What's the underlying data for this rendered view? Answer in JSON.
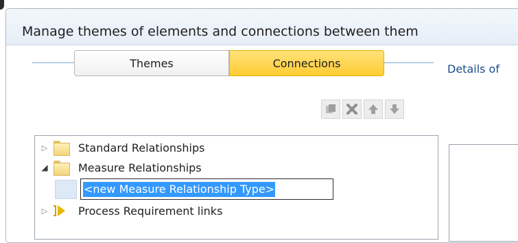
{
  "window": {
    "title": "Manage themes of elements and connections between them"
  },
  "tabs": [
    {
      "label": "Themes",
      "active": false
    },
    {
      "label": "Connections",
      "active": true
    }
  ],
  "details_label": "Details of",
  "toolbar": {
    "buttons": [
      {
        "icon": "copy-icon"
      },
      {
        "icon": "delete-icon"
      },
      {
        "icon": "move-up-icon"
      },
      {
        "icon": "move-down-icon"
      }
    ]
  },
  "tree": {
    "items": [
      {
        "label": "Standard Relationships",
        "expanded": false,
        "icon": "folder-icon"
      },
      {
        "label": "Measure Relationships",
        "expanded": true,
        "icon": "folder-icon"
      },
      {
        "label": "Process Requirement links",
        "expanded": false,
        "icon": "process-link-icon"
      }
    ],
    "editing": {
      "value": "<new Measure Relationship Type>"
    }
  },
  "colors": {
    "active_tab": "#ffcc33",
    "selection": "#3399ff",
    "link_text": "#1a4d8c",
    "divider": "#7fa7d6"
  }
}
